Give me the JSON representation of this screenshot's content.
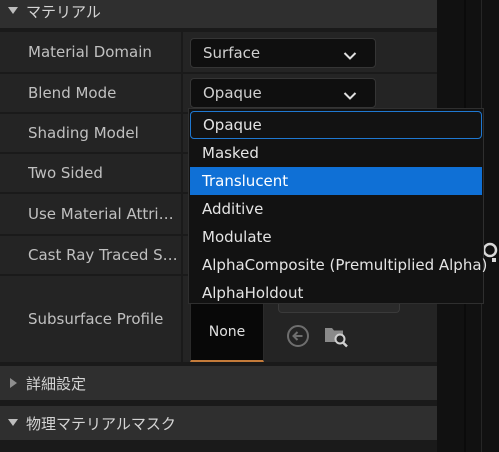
{
  "sections": {
    "material": {
      "title": "マテリアル"
    },
    "advanced": {
      "title": "詳細設定"
    },
    "physical_mask": {
      "title": "物理マテリアルマスク"
    }
  },
  "rows": [
    {
      "label": "Material Domain",
      "value": "Surface"
    },
    {
      "label": "Blend Mode",
      "value": "Opaque"
    },
    {
      "label": "Shading Model"
    },
    {
      "label": "Two Sided"
    },
    {
      "label": "Use Material Attri…"
    },
    {
      "label": "Cast Ray Traced S…"
    },
    {
      "label": "Subsurface Profile",
      "thumbnail": "None"
    }
  ],
  "dropdown": {
    "options": [
      "Opaque",
      "Masked",
      "Translucent",
      "Additive",
      "Modulate",
      "AlphaComposite (Premultiplied Alpha)",
      "AlphaHoldout"
    ],
    "focused": "Opaque",
    "highlighted": "Translucent"
  },
  "colors": {
    "selection": "#0f70d6",
    "focus_border": "#1f78d1",
    "thumbnail_accent": "#c47b3a"
  },
  "icons": [
    "triangle-down-icon",
    "triangle-right-icon",
    "chevron-down-icon",
    "arrow-left-circle-icon",
    "browse-folder-icon"
  ]
}
